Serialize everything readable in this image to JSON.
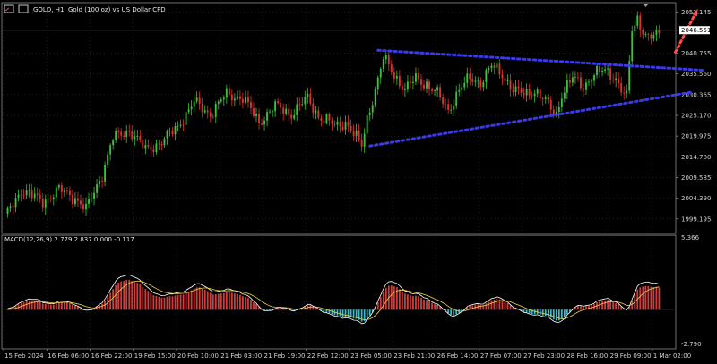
{
  "window": {
    "title": "GOLD, H1:  Gold (100 oz) vs US Dollar CFD",
    "icon": "chart-window-icon"
  },
  "chart_data": {
    "type": "candlestick",
    "symbol": "GOLD",
    "timeframe": "H1",
    "ylim": [
      1996.0,
      2053.0
    ],
    "price_axis_ticks": [
      "2051.145",
      "2040.755",
      "2035.560",
      "2030.365",
      "2025.170",
      "2019.975",
      "2014.780",
      "2009.585",
      "2004.390",
      "1999.195"
    ],
    "current_price": "2046.551",
    "date_axis_ticks": [
      "15 Feb 2024",
      "16 Feb 06:00",
      "16 Feb 22:00",
      "19 Feb 15:00",
      "20 Feb 10:00",
      "21 Feb 03:00",
      "21 Feb 19:00",
      "22 Feb 12:00",
      "23 Feb 05:00",
      "23 Feb 21:00",
      "26 Feb 14:00",
      "27 Feb 07:00",
      "27 Feb 23:00",
      "28 Feb 16:00",
      "29 Feb 09:00",
      "1 Mar 02:00"
    ],
    "price_path_keypoints": [
      [
        0,
        1999.5
      ],
      [
        6,
        2006.5
      ],
      [
        14,
        2003.5
      ],
      [
        20,
        2006.5
      ],
      [
        26,
        2004.5
      ],
      [
        30,
        2001.5
      ],
      [
        36,
        2010.5
      ],
      [
        40,
        2019.5
      ],
      [
        46,
        2021.5
      ],
      [
        52,
        2016.5
      ],
      [
        58,
        2018.5
      ],
      [
        64,
        2022.5
      ],
      [
        70,
        2028.5
      ],
      [
        76,
        2025.5
      ],
      [
        82,
        2030.5
      ],
      [
        88,
        2029.5
      ],
      [
        94,
        2023.5
      ],
      [
        100,
        2027.5
      ],
      [
        106,
        2025.5
      ],
      [
        112,
        2029.5
      ],
      [
        116,
        2025.0
      ],
      [
        122,
        2022.5
      ],
      [
        126,
        2023.5
      ],
      [
        132,
        2017.5
      ],
      [
        134,
        2024.5
      ],
      [
        138,
        2034.0
      ],
      [
        140,
        2039.5
      ],
      [
        144,
        2035.5
      ],
      [
        148,
        2031.5
      ],
      [
        152,
        2034.5
      ],
      [
        156,
        2033.0
      ],
      [
        160,
        2030.5
      ],
      [
        164,
        2026.5
      ],
      [
        168,
        2031.5
      ],
      [
        172,
        2034.5
      ],
      [
        176,
        2033.5
      ],
      [
        180,
        2037.5
      ],
      [
        184,
        2035.5
      ],
      [
        188,
        2031.5
      ],
      [
        192,
        2030.5
      ],
      [
        196,
        2031.5
      ],
      [
        200,
        2028.5
      ],
      [
        204,
        2025.5
      ],
      [
        206,
        2030.5
      ],
      [
        210,
        2034.5
      ],
      [
        214,
        2032.5
      ],
      [
        218,
        2035.5
      ],
      [
        222,
        2036.5
      ],
      [
        226,
        2034.5
      ],
      [
        228,
        2031.5
      ],
      [
        230,
        2029.5
      ],
      [
        231,
        2038.5
      ],
      [
        232,
        2046.5
      ],
      [
        234,
        2049.5
      ],
      [
        236,
        2046.5
      ],
      [
        238,
        2044.5
      ],
      [
        240,
        2045.0
      ],
      [
        242,
        2045.5
      ]
    ],
    "trendlines": [
      {
        "name": "triangle-upper",
        "color": "#3a3ae8",
        "style": "dotted",
        "from": [
          138,
          2041.5
        ],
        "to": [
          258,
          2036.5
        ]
      },
      {
        "name": "triangle-lower",
        "color": "#3a3ae8",
        "style": "dotted",
        "from": [
          135,
          2017.5
        ],
        "to": [
          254,
          2031.0
        ]
      },
      {
        "name": "breakout-arrow",
        "color": "#ff4d4d",
        "style": "dotted-arrow",
        "from": [
          248,
          2041.0
        ],
        "to": [
          256,
          2051.5
        ]
      }
    ],
    "macd": {
      "label": "MACD(12,26,9) 2.779 2.837 0.000 -0.117",
      "ylim": [
        -2.79,
        5.366
      ],
      "axis_ticks": [
        "5.366",
        "-2.790"
      ],
      "histogram_colors": {
        "positive": "#d23b3b",
        "negative": "#3eb8c8"
      },
      "macd_color": "#ffffff",
      "signal_color": "#f0d24a"
    },
    "colors": {
      "bull": "#3ac23a",
      "bear": "#e03131",
      "grid": "#4a4a4a",
      "price_line": "#7c7c7c"
    }
  }
}
